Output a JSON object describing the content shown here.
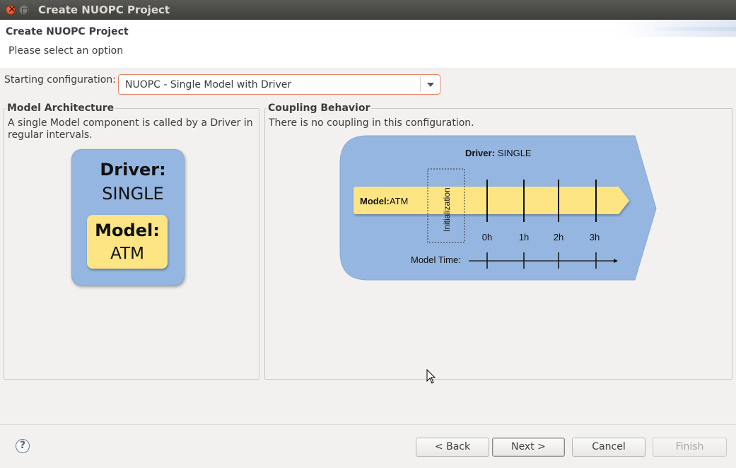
{
  "window": {
    "title": "Create NUOPC Project"
  },
  "header": {
    "title": "Create NUOPC Project",
    "subtitle": "Please select an option"
  },
  "config": {
    "label": "Starting configuration:",
    "selected": "NUOPC - Single Model with Driver"
  },
  "model_architecture": {
    "legend": "Model Architecture",
    "description_line1": "A single Model component is called by a Driver in",
    "description_line2": "regular intervals.",
    "driver_label": "Driver:",
    "driver_value": "SINGLE",
    "model_label": "Model:",
    "model_value": "ATM"
  },
  "coupling_behavior": {
    "legend": "Coupling Behavior",
    "description": "There is no coupling in this configuration.",
    "driver_label": "Driver:",
    "driver_value": "SINGLE",
    "model_label": "Model:",
    "model_value": "ATM",
    "init_label": "Initialization",
    "ticks": [
      "0h",
      "1h",
      "2h",
      "3h"
    ],
    "time_label": "Model Time:"
  },
  "buttons": {
    "help": "?",
    "back": "< Back",
    "next": "Next >",
    "cancel": "Cancel",
    "finish": "Finish"
  },
  "colors": {
    "diagram_blue": "#95b6e0",
    "model_yellow": "#fde584",
    "combo_border": "#e9836a"
  }
}
